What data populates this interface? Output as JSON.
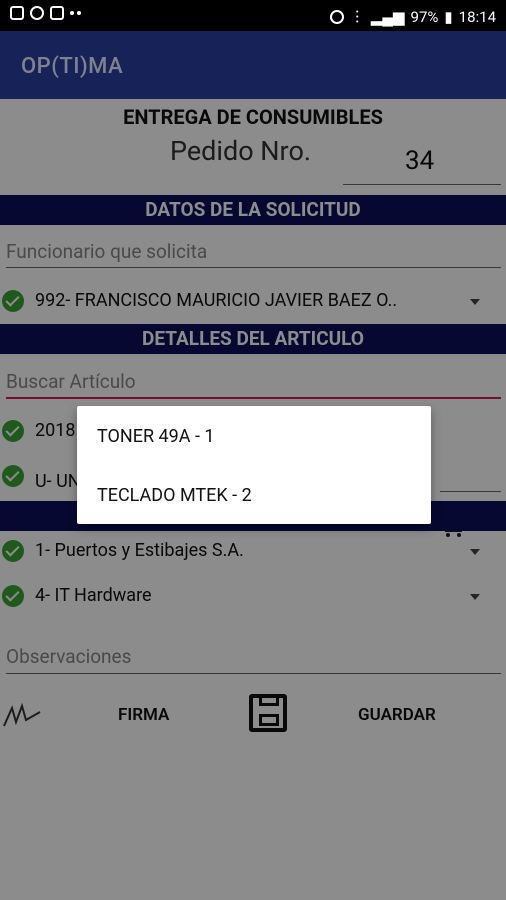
{
  "statusbar": {
    "time": "18:14",
    "battery": "97%",
    "icons_left": [
      "image-icon",
      "chat-icon",
      "mail-icon",
      "dots-icon"
    ],
    "icons_right": [
      "alarm-icon",
      "wifi-icon",
      "signal-icon",
      "battery-icon"
    ]
  },
  "toolbar": {
    "title": "OP(TI)MA"
  },
  "form": {
    "heading": "ENTREGA DE CONSUMIBLES",
    "pedido_label": "Pedido Nro.",
    "pedido_value": "34",
    "section1": "DATOS DE LA SOLICITUD",
    "funcionario_hint": "Funcionario que solicita",
    "funcionario_value": "992- FRANCISCO MAURICIO JAVIER BAEZ O..",
    "section2": "DETALLES DEL ARTICULO",
    "buscar_hint": "Buscar Artículo",
    "articulo_value": "2018",
    "unidad_value": "U- UN",
    "proveedor_value": "1- Puertos y Estibajes S.A.",
    "categoria_value": "4- IT Hardware",
    "observaciones_hint": "Observaciones",
    "firma_label": "FIRMA",
    "guardar_label": "GUARDAR"
  },
  "popup": {
    "items": [
      "TONER 49A - 1",
      "TECLADO MTEK - 2"
    ]
  },
  "colors": {
    "toolbar": "#2b3ea0",
    "section_band": "#0c0f5a",
    "check": "#3aa335",
    "accent_line": "#d81b60"
  }
}
